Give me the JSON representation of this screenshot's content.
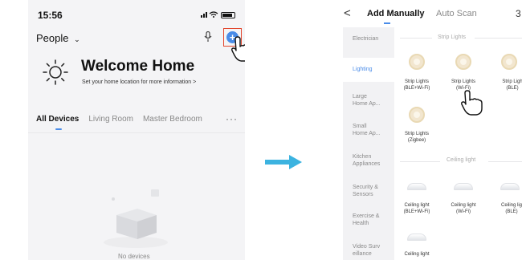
{
  "left_screen": {
    "status_time": "15:56",
    "status_icons": "▐▐ ≡",
    "home_selector": "People",
    "welcome_title": "Welcome Home",
    "welcome_subtitle": "Set your home location for more information >",
    "room_tabs": [
      "All Devices",
      "Living Room",
      "Master Bedroom"
    ],
    "more_label": "···",
    "empty_text": "No devices"
  },
  "right_screen": {
    "back_glyph": "<",
    "tabs": [
      "Add Manually",
      "Auto Scan",
      "3"
    ],
    "sidebar": [
      {
        "label": "Electrician",
        "active": false
      },
      {
        "label": "Lighting",
        "active": true
      },
      {
        "label": "Large Home Ap...",
        "active": false
      },
      {
        "label": "Small Home Ap...",
        "active": false
      },
      {
        "label": "Kitchen Appliances",
        "active": false
      },
      {
        "label": "Security & Sensors",
        "active": false
      },
      {
        "label": "Exercise & Health",
        "active": false
      },
      {
        "label": "Video Surv eillance",
        "active": false
      }
    ],
    "sections": {
      "strip": "Strip Lights",
      "ceiling": "Ceiling light"
    },
    "strip_devices": [
      {
        "line1": "Strip Lights",
        "line2": "(BLE+Wi-Fi)"
      },
      {
        "line1": "Strip Lights",
        "line2": "(Wi-Fi)"
      },
      {
        "line1": "Strip Ligh",
        "line2": "(BLE)"
      },
      {
        "line1": "Strip Lights",
        "line2": "(Zigbee)"
      }
    ],
    "ceiling_devices": [
      {
        "line1": "Ceiling light",
        "line2": "(BLE+Wi-Fi)"
      },
      {
        "line1": "Ceiling light",
        "line2": "(Wi-Fi)"
      },
      {
        "line1": "Ceiling lig",
        "line2": "(BLE)"
      },
      {
        "line1": "Ceiling light",
        "line2": ""
      }
    ]
  },
  "colors": {
    "accent": "#4a8ce8",
    "highlight_box": "#e2452c",
    "arrow": "#3cb3e0"
  }
}
